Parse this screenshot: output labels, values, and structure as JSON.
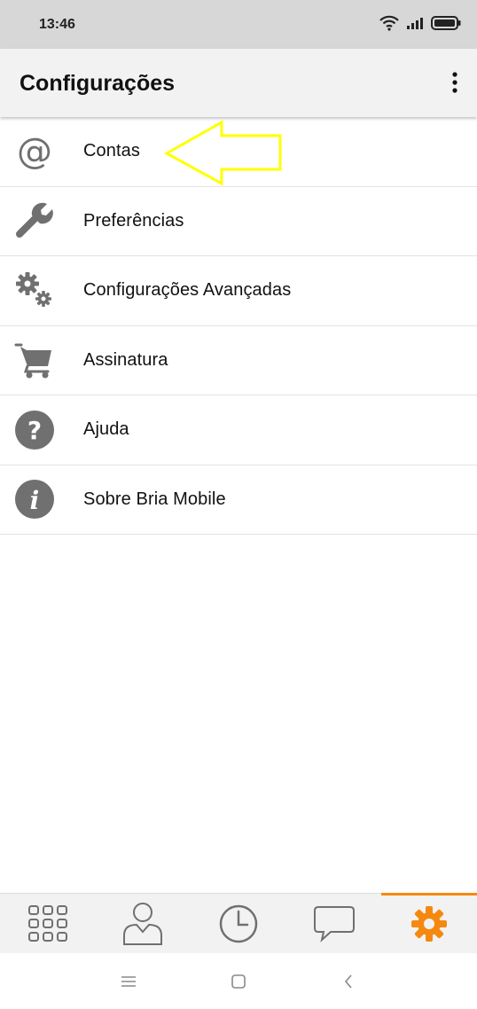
{
  "status_bar": {
    "time": "13:46"
  },
  "app_bar": {
    "title": "Configurações"
  },
  "settings": {
    "items": [
      {
        "label": "Contas",
        "icon": "at-sign-icon"
      },
      {
        "label": "Preferências",
        "icon": "wrench-icon"
      },
      {
        "label": "Configurações Avançadas",
        "icon": "gears-icon"
      },
      {
        "label": "Assinatura",
        "icon": "cart-icon"
      },
      {
        "label": "Ajuda",
        "icon": "help-icon"
      },
      {
        "label": "Sobre Bria Mobile",
        "icon": "info-icon"
      }
    ]
  },
  "bottom_nav": {
    "tabs": [
      {
        "icon": "dialpad-icon",
        "active": false
      },
      {
        "icon": "contacts-icon",
        "active": false
      },
      {
        "icon": "history-icon",
        "active": false
      },
      {
        "icon": "messages-icon",
        "active": false
      },
      {
        "icon": "settings-gear-icon",
        "active": true
      }
    ]
  },
  "colors": {
    "accent": "#f5890f",
    "icon_gray": "#707070",
    "annotation": "#ffff00"
  }
}
